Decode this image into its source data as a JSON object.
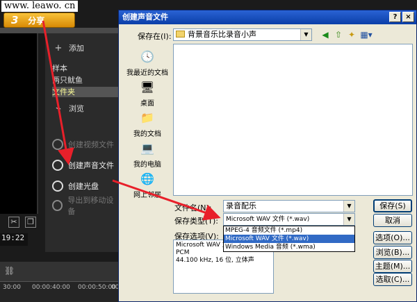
{
  "watermark": "www. leawo. cn",
  "app": {
    "step_number": "3",
    "step_label": "分享",
    "add_label": "添加",
    "browse_label": "浏览",
    "list_items": [
      "样本",
      "两只鱿鱼",
      "文件夹"
    ],
    "menu": {
      "create_video": "创建视频文件",
      "create_audio": "创建声音文件",
      "create_disc": "创建光盘",
      "export_mobile": "导出到移动设备"
    },
    "timecode": "19:22",
    "ruler_ticks": [
      "30:00",
      "00:00:40:00",
      "00:00:50:00",
      "00"
    ]
  },
  "dialog": {
    "title": "创建声音文件",
    "help_label": "?",
    "close_label": "×",
    "save_in_label": "保存在(I):",
    "save_in_value": "背景音乐比录音小声",
    "places": [
      {
        "label": "我最近的文档",
        "icon": "recent-documents-icon"
      },
      {
        "label": "桌面",
        "icon": "desktop-icon"
      },
      {
        "label": "我的文档",
        "icon": "my-documents-icon"
      },
      {
        "label": "我的电脑",
        "icon": "my-computer-icon"
      },
      {
        "label": "网上邻居",
        "icon": "network-places-icon"
      }
    ],
    "filename_label": "文件名(N):",
    "filename_value": "录音配乐",
    "filetype_label": "保存类型(T):",
    "filetype_value": "Microsoft WAV 文件 (*.wav)",
    "filetype_options": [
      "MPEG-4 音频文件 (*.mp4)",
      "Microsoft WAV 文件 (*.wav)",
      "Windows Media 音频 (*.wma)"
    ],
    "save_options_label": "保存选项(V):",
    "save_options_lines": [
      "Microsoft WAV 文件",
      "PCM",
      "44.100 kHz, 16 位, 立体声"
    ],
    "buttons": {
      "save": "保存(S)",
      "cancel": "取消",
      "options": "选项(O)...",
      "browse": "浏览(B)...",
      "subject": "主题(M)...",
      "select": "选取(C)..."
    }
  },
  "colors": {
    "titlebar": "#0a3ea8",
    "dialog_bg": "#ece9d8",
    "arrow": "#e8202a",
    "selection": "#316ac5",
    "step_tab": "#e99a10"
  }
}
